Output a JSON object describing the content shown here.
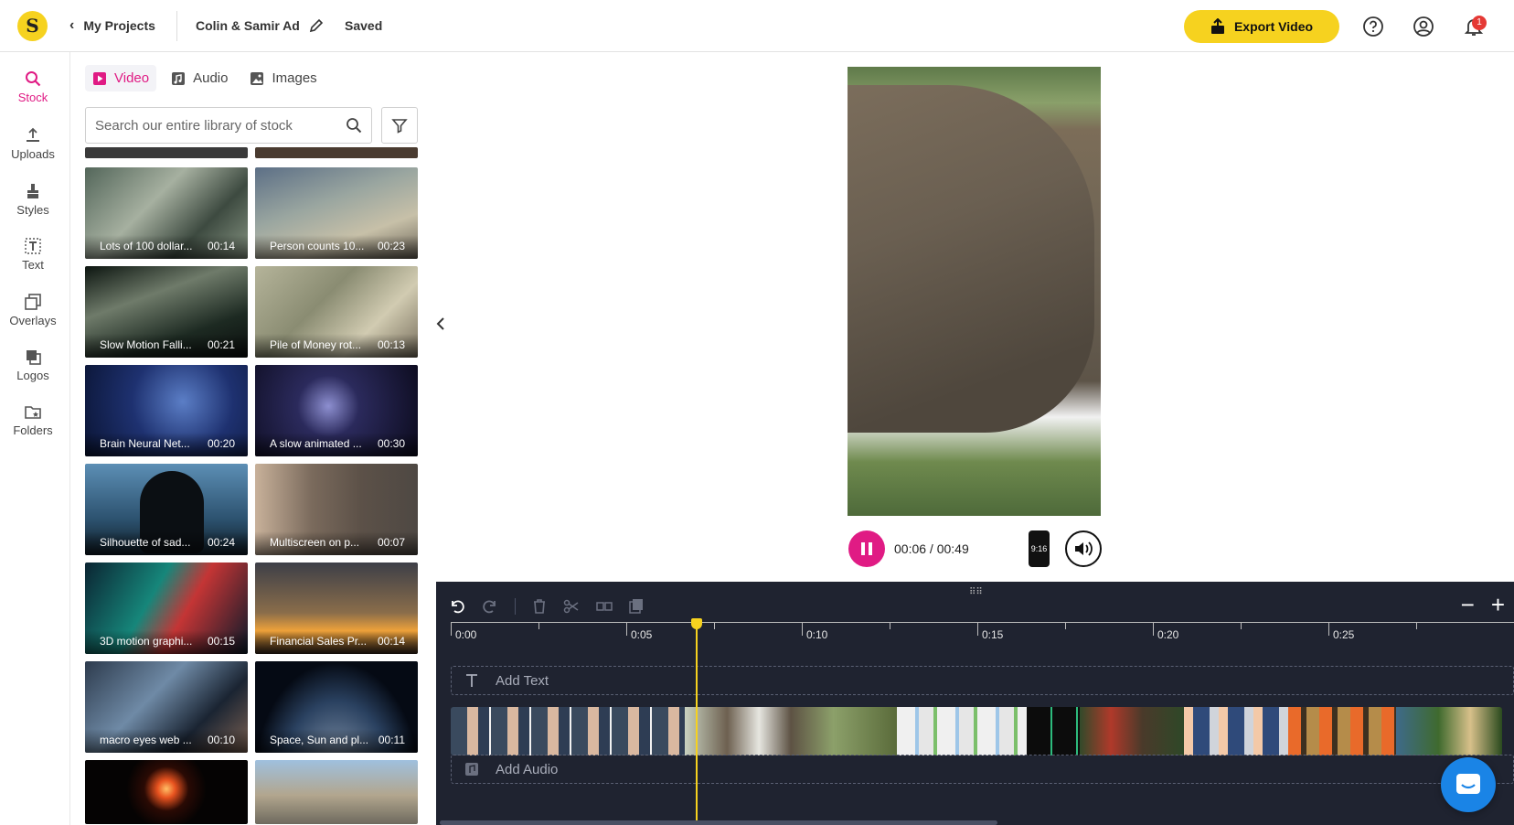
{
  "header": {
    "logo_letter": "S",
    "back_label": "My Projects",
    "project_name": "Colin & Samir Ad",
    "status": "Saved",
    "export_label": "Export Video",
    "notification_count": "1"
  },
  "rail": {
    "items": [
      {
        "label": "Stock",
        "icon": "search-icon"
      },
      {
        "label": "Uploads",
        "icon": "upload-icon"
      },
      {
        "label": "Styles",
        "icon": "brush-icon"
      },
      {
        "label": "Text",
        "icon": "text-icon"
      },
      {
        "label": "Overlays",
        "icon": "overlays-icon"
      },
      {
        "label": "Logos",
        "icon": "logos-icon"
      },
      {
        "label": "Folders",
        "icon": "folder-icon"
      }
    ]
  },
  "panel": {
    "tabs": [
      {
        "label": "Video",
        "icon": "video-icon",
        "active": true
      },
      {
        "label": "Audio",
        "icon": "music-icon",
        "active": false
      },
      {
        "label": "Images",
        "icon": "image-icon",
        "active": false
      }
    ],
    "search_placeholder": "Search our entire library of stock",
    "clips": [
      {
        "title": "Lots of 100 dollar...",
        "duration": "00:14"
      },
      {
        "title": "Person counts 10...",
        "duration": "00:23"
      },
      {
        "title": "Slow Motion Falli...",
        "duration": "00:21"
      },
      {
        "title": "Pile of Money rot...",
        "duration": "00:13"
      },
      {
        "title": "Brain Neural Net...",
        "duration": "00:20"
      },
      {
        "title": "A slow animated ...",
        "duration": "00:30"
      },
      {
        "title": "Silhouette of sad...",
        "duration": "00:24"
      },
      {
        "title": "Multiscreen on p...",
        "duration": "00:07"
      },
      {
        "title": "3D motion graphi...",
        "duration": "00:15"
      },
      {
        "title": "Financial Sales Pr...",
        "duration": "00:14"
      },
      {
        "title": "macro eyes web ...",
        "duration": "00:10"
      },
      {
        "title": "Space, Sun and pl...",
        "duration": "00:11"
      }
    ]
  },
  "player": {
    "time": "00:06 / 00:49",
    "aspect_ratio": "9:16"
  },
  "timeline": {
    "ruler": [
      "0:00",
      "0:05",
      "0:10",
      "0:15",
      "0:20",
      "0:25"
    ],
    "add_text_label": "Add Text",
    "add_audio_label": "Add Audio",
    "zoom_out": "−",
    "zoom_in": "+"
  },
  "colors": {
    "accent_pink": "#e01b84",
    "brand_yellow": "#f6d21f",
    "timeline_bg": "#1f2330"
  }
}
